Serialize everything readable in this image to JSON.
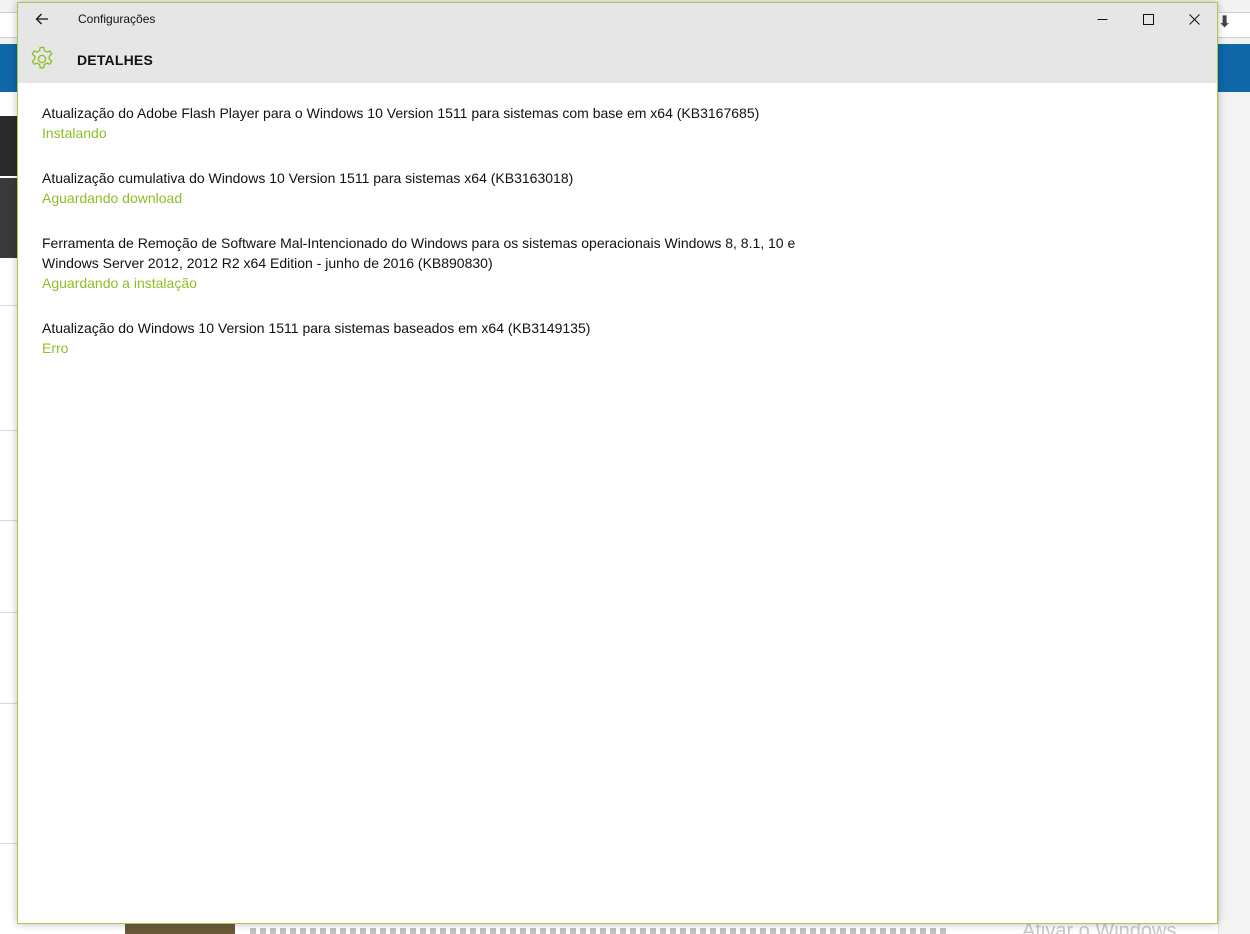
{
  "window": {
    "title": "Configurações",
    "header_title": "DETALHES"
  },
  "updates": [
    {
      "name": "Atualização do Adobe Flash Player para o Windows 10 Version 1511 para sistemas com base em x64 (KB3167685)",
      "status": "Instalando"
    },
    {
      "name": "Atualização cumulativa do Windows 10 Version 1511 para sistemas x64 (KB3163018)",
      "status": "Aguardando download"
    },
    {
      "name_line1": "Ferramenta de Remoção de Software Mal-Intencionado do Windows para os sistemas operacionais Windows 8, 8.1, 10 e",
      "name_line2": "Windows Server 2012, 2012 R2 x64 Edition - junho de 2016 (KB890830)",
      "status": "Aguardando a instalação"
    },
    {
      "name": "Atualização do Windows 10 Version 1511 para sistemas baseados em x64 (KB3149135)",
      "status": "Erro"
    }
  ],
  "background": {
    "watermark": "Ativar o Windows"
  },
  "colors": {
    "accent": "#8cbf26",
    "titlebar": "#e6e6e6",
    "window_border": "#a8c94a"
  },
  "icons": {
    "back": "back-arrow-icon",
    "minimize": "minimize-icon",
    "maximize": "maximize-icon",
    "close": "close-icon",
    "settings": "gear-icon"
  }
}
